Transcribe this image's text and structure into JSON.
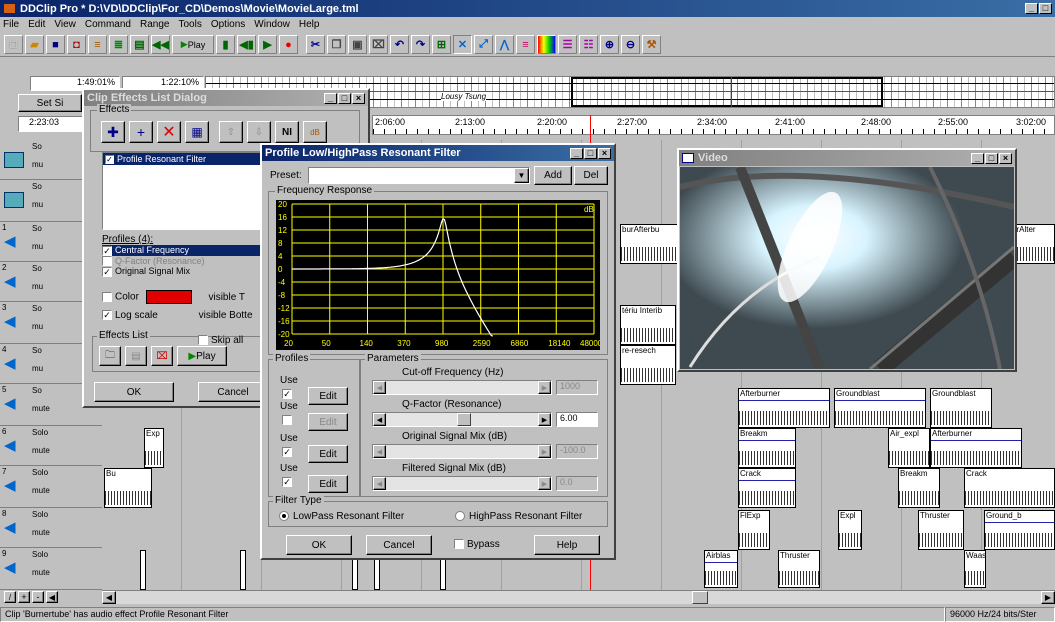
{
  "app": {
    "title": "DDClip Pro * D:\\VD\\DDClip\\For_CD\\Demos\\Movie\\MovieLarge.tml"
  },
  "menu": [
    "File",
    "Edit",
    "View",
    "Command",
    "Range",
    "Tools",
    "Options",
    "Window",
    "Help"
  ],
  "toolbar": {
    "play_label": "Play"
  },
  "header": {
    "time1": "1:49:01%",
    "time2": "1:22:10%",
    "set_label": "Set Si",
    "pos": "2:23:03"
  },
  "ruler": [
    "2:06:00",
    "2:13:00",
    "2:20:00",
    "2:27:00",
    "2:34:00",
    "2:41:00",
    "2:48:00",
    "2:55:00",
    "3:02:00"
  ],
  "overview": {
    "title": "Lousy Tsung"
  },
  "tracks": [
    {
      "num": "",
      "solo": "So",
      "mute": "mu"
    },
    {
      "num": "",
      "solo": "So",
      "mute": "mu"
    },
    {
      "num": "1",
      "solo": "So",
      "mute": "mu"
    },
    {
      "num": "2",
      "solo": "So",
      "mute": "mu"
    },
    {
      "num": "3",
      "solo": "So",
      "mute": "mu"
    },
    {
      "num": "4",
      "solo": "So",
      "mute": "mu"
    },
    {
      "num": "5",
      "solo": "So",
      "mute": "mute"
    },
    {
      "num": "6",
      "solo": "Solo",
      "mute": "mute"
    },
    {
      "num": "7",
      "solo": "Solo",
      "mute": "mute"
    },
    {
      "num": "8",
      "solo": "Solo",
      "mute": "mute"
    },
    {
      "num": "9",
      "solo": "Solo",
      "mute": "mute"
    }
  ],
  "clips": {
    "afterburner": "Afterburner",
    "groundblast": "Groundblast",
    "groundblast2": "Groundblast",
    "breakm": "Breakm",
    "air_expl": "Air_expl",
    "afterburner2": "Afterburner",
    "crack": "Crack",
    "breakm2": "Breakm",
    "crack2": "Crack",
    "flexp": "FlExp",
    "expl": "Expl",
    "thruster": "Thruster",
    "ground_b": "Ground_b",
    "airblas": "Airblas",
    "thruster2": "Thruster",
    "waas": "Waas",
    "exp": "Exp",
    "burnerbu": "burAfterbu",
    "afterbu": "Afterbu",
    "ntierib": "tériu Interib",
    "tbesech": "re-resech",
    "bur": "Bu",
    "alter": "urAlter"
  },
  "effects_dialog": {
    "title": "Clip Effects List Dialog",
    "group": "Effects",
    "list": [
      "Profile Resonant Filter"
    ],
    "profiles_label": "Profiles (4):",
    "profiles": [
      {
        "label": "Central Frequency",
        "checked": true,
        "selected": true
      },
      {
        "label": "Q-Factor (Resonance)",
        "checked": false,
        "grey": true
      },
      {
        "label": "Original Signal Mix",
        "checked": true
      }
    ],
    "color_label": "Color",
    "visible_t": "visible T",
    "log_scale": "Log scale",
    "visible_b": "visible Botte",
    "effects_list_label": "Effects List",
    "skip_all": "Skip all",
    "play": "Play",
    "ok": "OK",
    "cancel": "Cancel"
  },
  "filter_dialog": {
    "title": "Profile Low/HighPass Resonant Filter",
    "preset_label": "Preset:",
    "add": "Add",
    "del": "Del",
    "freq_group": "Frequency Response",
    "db_label": "dB",
    "y_ticks": [
      "20",
      "16",
      "12",
      "8",
      "4",
      "0",
      "-4",
      "-8",
      "-12",
      "-16",
      "-20"
    ],
    "x_ticks": [
      "20",
      "50",
      "140",
      "370",
      "980",
      "2590",
      "6860",
      "18140",
      "48000"
    ],
    "profiles_group": "Profiles",
    "params_group": "Parameters",
    "use": "Use",
    "edit": "Edit",
    "params": [
      {
        "label": "Cut-off Frequency (Hz)",
        "value": "1000",
        "grey": true
      },
      {
        "label": "Q-Factor (Resonance)",
        "value": "6.00",
        "grey": false
      },
      {
        "label": "Original Signal Mix (dB)",
        "value": "-100.0",
        "grey": true
      },
      {
        "label": "Filtered Signal Mix (dB)",
        "value": "0.0",
        "grey": true
      }
    ],
    "filter_type": "Filter Type",
    "lowpass": "LowPass Resonant Filter",
    "highpass": "HighPass Resonant Filter",
    "ok": "OK",
    "cancel": "Cancel",
    "bypass": "Bypass",
    "help": "Help"
  },
  "video": {
    "title": "Video"
  },
  "status": {
    "left": "Clip 'Burnertube' has audio effect Profile Resonant Filter",
    "right": "96000 Hz/24 bits/Ster"
  },
  "colors": {
    "title_active": "#0a246a",
    "chart_bg": "#000000",
    "chart_grid": "#ffff00",
    "curve": "#ffffff",
    "playhead": "#ff0000",
    "clip_swatch": "#e00000"
  }
}
